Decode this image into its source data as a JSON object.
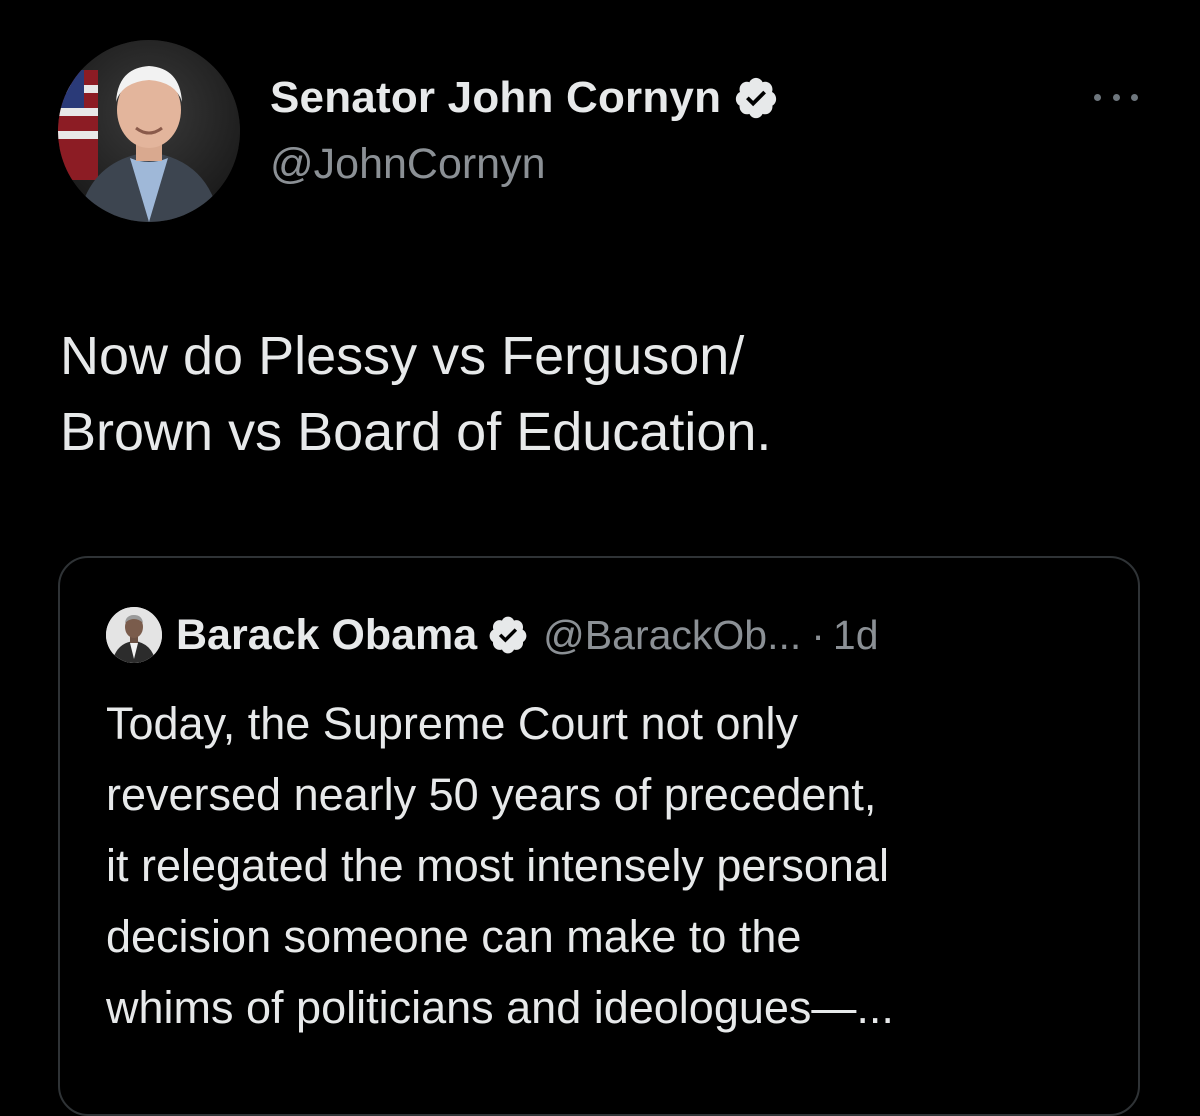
{
  "tweet": {
    "author": {
      "name": "Senator John Cornyn",
      "handle": "@JohnCornyn"
    },
    "text_lines": [
      "Now do Plessy vs Ferguson/",
      "Brown vs Board of Education."
    ]
  },
  "quoted_tweet": {
    "author": {
      "name": "Barack Obama",
      "handle": "@BarackOb...",
      "separator": "·",
      "time": "1d"
    },
    "text_lines": [
      "Today, the Supreme Court not only",
      "reversed nearly 50 years of precedent,",
      "it relegated the most intensely personal",
      "decision someone can make to the",
      "whims of politicians and ideologues—..."
    ]
  },
  "icons": {
    "verified": "verified-badge-icon",
    "more": "more-options-icon"
  },
  "colors": {
    "background": "#000000",
    "primary_text": "#e7e9ea",
    "secondary_text": "#8b9095",
    "border": "#2f3336"
  }
}
